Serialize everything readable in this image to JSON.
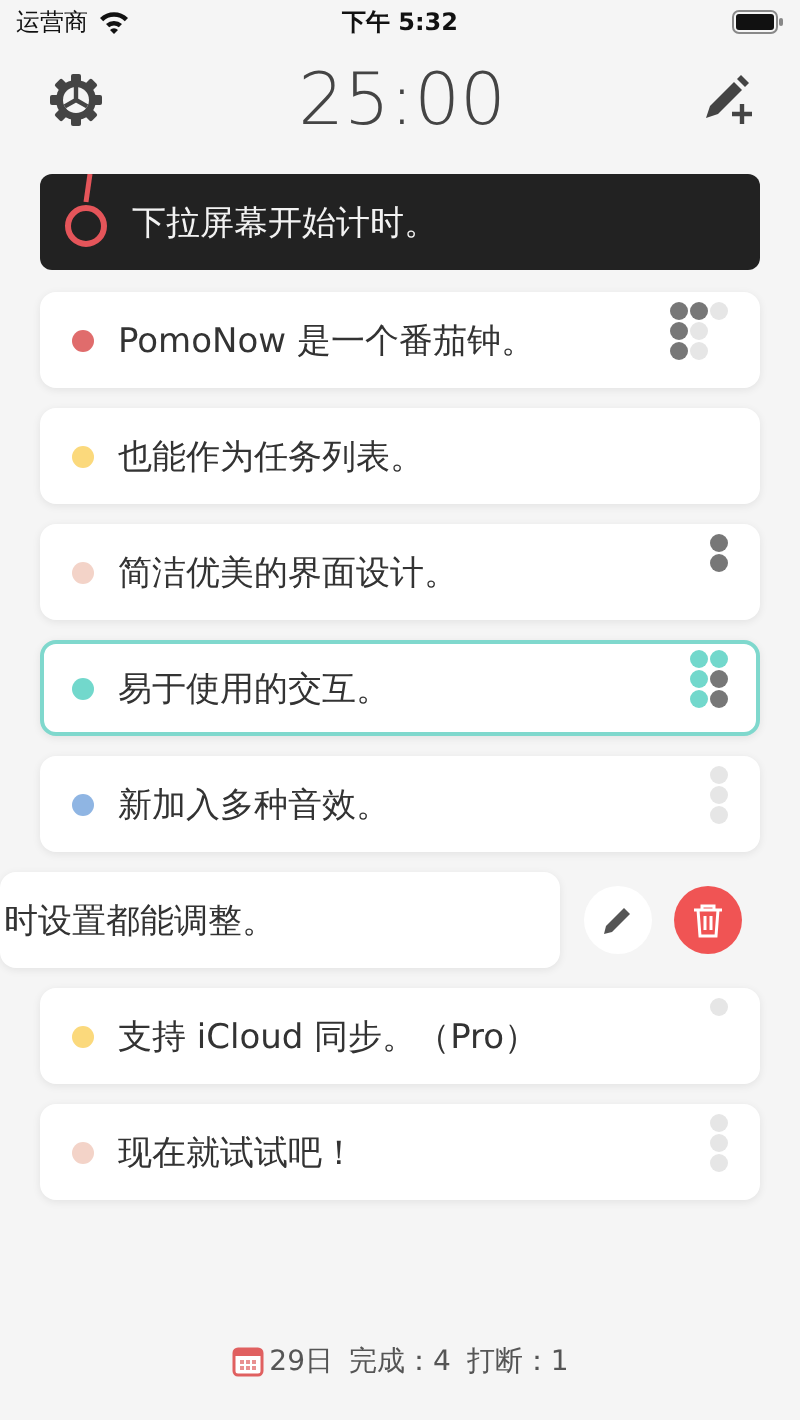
{
  "status_bar": {
    "carrier": "运营商",
    "time": "下午 5:32"
  },
  "header": {
    "timer": "25:00"
  },
  "banner": {
    "text": "下拉屏幕开始计时。"
  },
  "tasks": [
    {
      "text": "PomoNow 是一个番茄钟。",
      "color": "#e06c6c",
      "selected": false,
      "swiped": false,
      "pomodoros": [
        {
          "kind": "done"
        },
        {
          "kind": "done"
        },
        {
          "kind": "done"
        },
        {
          "kind": "done"
        },
        {
          "kind": "planned"
        },
        {
          "kind": "planned"
        },
        {
          "kind": "planned"
        }
      ]
    },
    {
      "text": "也能作为任务列表。",
      "color": "#fbd97c",
      "selected": false,
      "swiped": false
    },
    {
      "text": "简洁优美的界面设计。",
      "color": "#f3d3c8",
      "selected": false,
      "swiped": false,
      "pomodoros": [
        {
          "kind": "done"
        },
        {
          "kind": "done"
        }
      ]
    },
    {
      "text": "易于使用的交互。",
      "color": "#72d8cc",
      "selected": true,
      "swiped": false,
      "pomodoros": [
        {
          "kind": "active"
        },
        {
          "kind": "active"
        },
        {
          "kind": "active"
        },
        {
          "kind": "active"
        },
        {
          "kind": "done"
        },
        {
          "kind": "done"
        }
      ]
    },
    {
      "text": "新加入多种音效。",
      "color": "#8fb5e3",
      "selected": false,
      "swiped": false,
      "pomodoros": [
        {
          "kind": "planned"
        },
        {
          "kind": "planned"
        },
        {
          "kind": "planned"
        }
      ]
    },
    {
      "text": "时设置都能调整。",
      "selected": false,
      "swiped": true
    },
    {
      "text": "支持 iCloud 同步。（Pro）",
      "color": "#fbd97c",
      "selected": false,
      "swiped": false,
      "pomodoros": [
        {
          "kind": "planned"
        }
      ]
    },
    {
      "text": "现在就试试吧！",
      "color": "#f3d3c8",
      "selected": false,
      "swiped": false,
      "pomodoros": [
        {
          "kind": "planned"
        },
        {
          "kind": "planned"
        },
        {
          "kind": "planned"
        }
      ]
    }
  ],
  "footer": {
    "date": "29日",
    "completed": "完成：4",
    "interrupted": "打断：1"
  }
}
